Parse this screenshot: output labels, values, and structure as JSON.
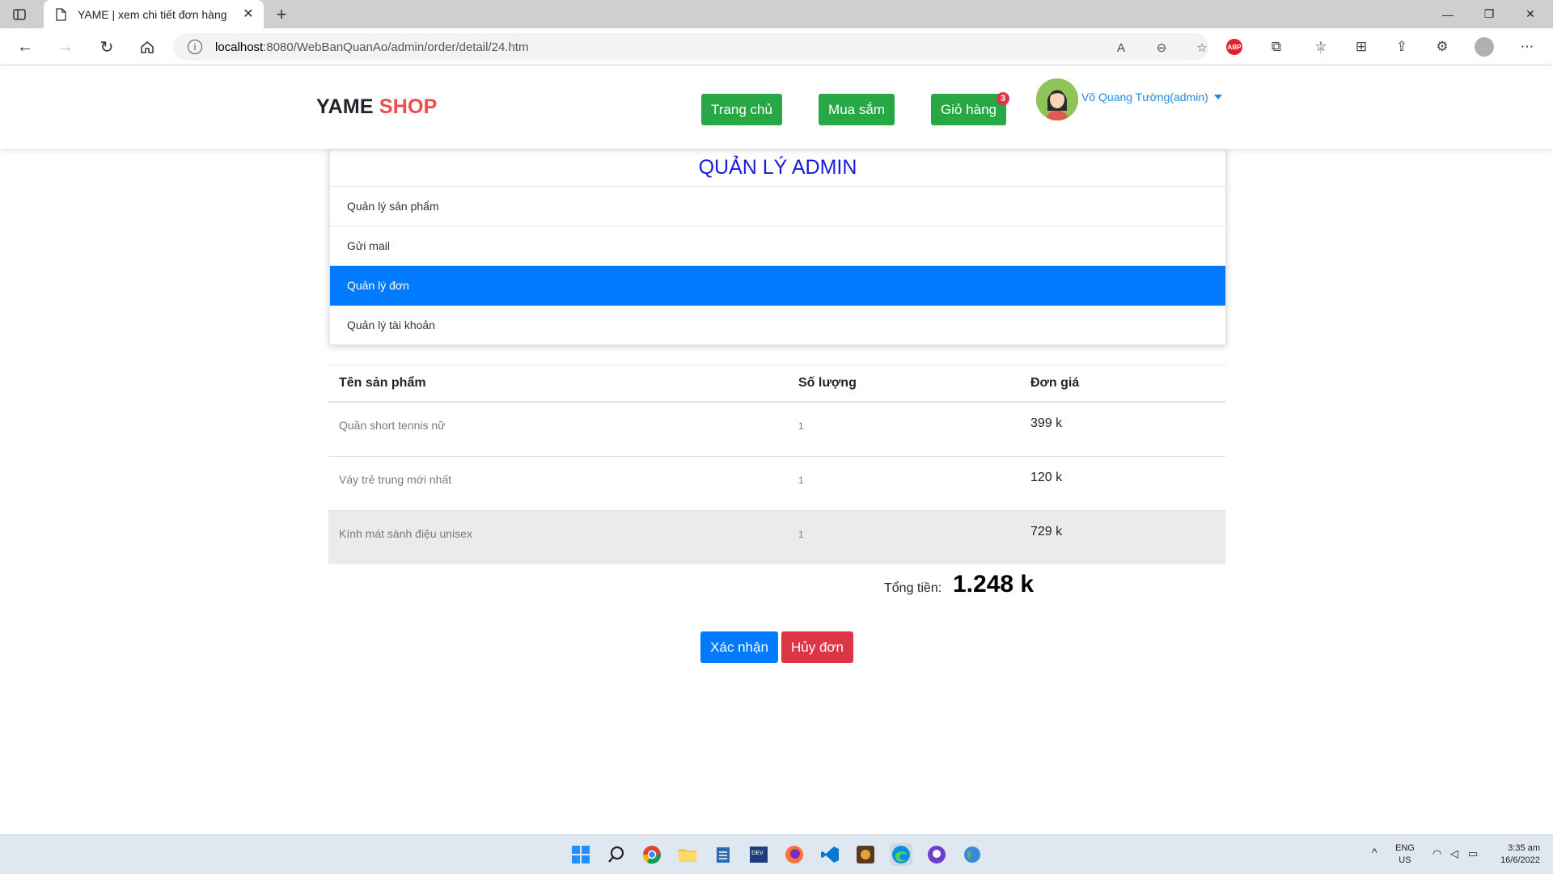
{
  "browser": {
    "tab_title": "YAME | xem chi tiết đơn hàng",
    "url_host": "localhost",
    "url_path": ":8080/WebBanQuanAo/admin/order/detail/24.htm"
  },
  "header": {
    "brand_primary": "YAME",
    "brand_secondary": "SHOP",
    "nav": {
      "home": "Trang chủ",
      "shop": "Mua sắm",
      "cart": "Giỏ hàng",
      "cart_count": "3"
    },
    "user_name": "Võ Quang Tường(admin)"
  },
  "admin": {
    "title": "QUẢN LÝ ADMIN",
    "menu": [
      {
        "label": "Quản lý sản phẩm"
      },
      {
        "label": "Gửi mail"
      },
      {
        "label": "Quản lý đơn"
      },
      {
        "label": "Quản lý tài khoản"
      }
    ],
    "active_item": "Quản lý đơn"
  },
  "table": {
    "headers": [
      "Tên sản phẩm",
      "Số lượng",
      "Đơn giá"
    ],
    "rows": [
      {
        "name": "Quần short tennis nữ",
        "qty": "1",
        "price": "399 k"
      },
      {
        "name": "Váy trẻ trung mới nhất",
        "qty": "1",
        "price": "120 k"
      },
      {
        "name": "Kính mát sành điệu unisex",
        "qty": "1",
        "price": "729 k"
      }
    ]
  },
  "summary": {
    "total_label": "Tổng tiền:",
    "total_value": "1.248 k"
  },
  "actions": {
    "confirm": "Xác nhận",
    "cancel": "Hủy đơn"
  },
  "taskbar": {
    "lang_top": "ENG",
    "lang_bottom": "US",
    "time": "3:35 am",
    "date": "16/6/2022"
  },
  "colors": {
    "primary": "#007bff",
    "success": "#28a745",
    "danger": "#dc3545",
    "brand_red": "#f04a4a",
    "admin_title": "#1a1adc"
  }
}
